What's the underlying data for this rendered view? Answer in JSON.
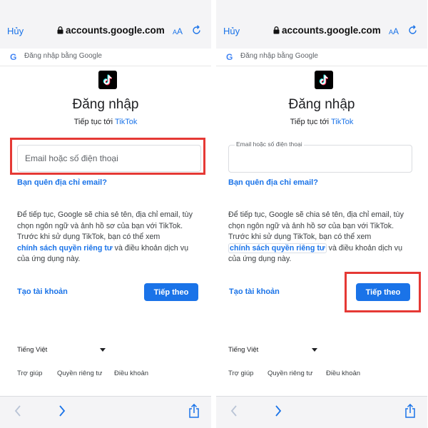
{
  "browser": {
    "cancel_label": "Hủy",
    "url": "accounts.google.com",
    "text_size_label": "AA"
  },
  "google_bar": {
    "logo_letter": "G",
    "text": "Đăng nhập bằng Google"
  },
  "signin": {
    "title": "Đăng nhập",
    "subtitle_prefix": "Tiếp tục tới",
    "app_name": "TikTok",
    "email_placeholder": "Email hoặc số điện thoại",
    "email_label": "Email hoặc số điện thoại",
    "forgot_email": "Bạn quên địa chỉ email?",
    "disclosure_text": "Để tiếp tục, Google sẽ chia sẻ tên, địa chỉ email, tùy chọn ngôn ngữ và ảnh hồ sơ của bạn với TikTok. Trước khi sử dụng TikTok, bạn có thể xem",
    "privacy_link": "chính sách quyền riêng tư",
    "disclosure_suffix": "và điều khoản dịch vụ của ứng dụng này.",
    "create_account": "Tạo tài khoản",
    "next_button": "Tiếp theo"
  },
  "footer": {
    "language": "Tiếng Việt",
    "help": "Trợ giúp",
    "privacy": "Quyền riêng tư",
    "terms": "Điều khoản"
  },
  "icons": {
    "lock": "lock-icon",
    "reload": "reload-icon",
    "back": "chevron-left-icon",
    "forward": "chevron-right-icon",
    "share": "share-icon",
    "app": "tiktok-icon"
  },
  "colors": {
    "link_blue": "#1a73e8",
    "highlight_red": "#e53935",
    "toolbar_bg": "#f4f4f6"
  }
}
